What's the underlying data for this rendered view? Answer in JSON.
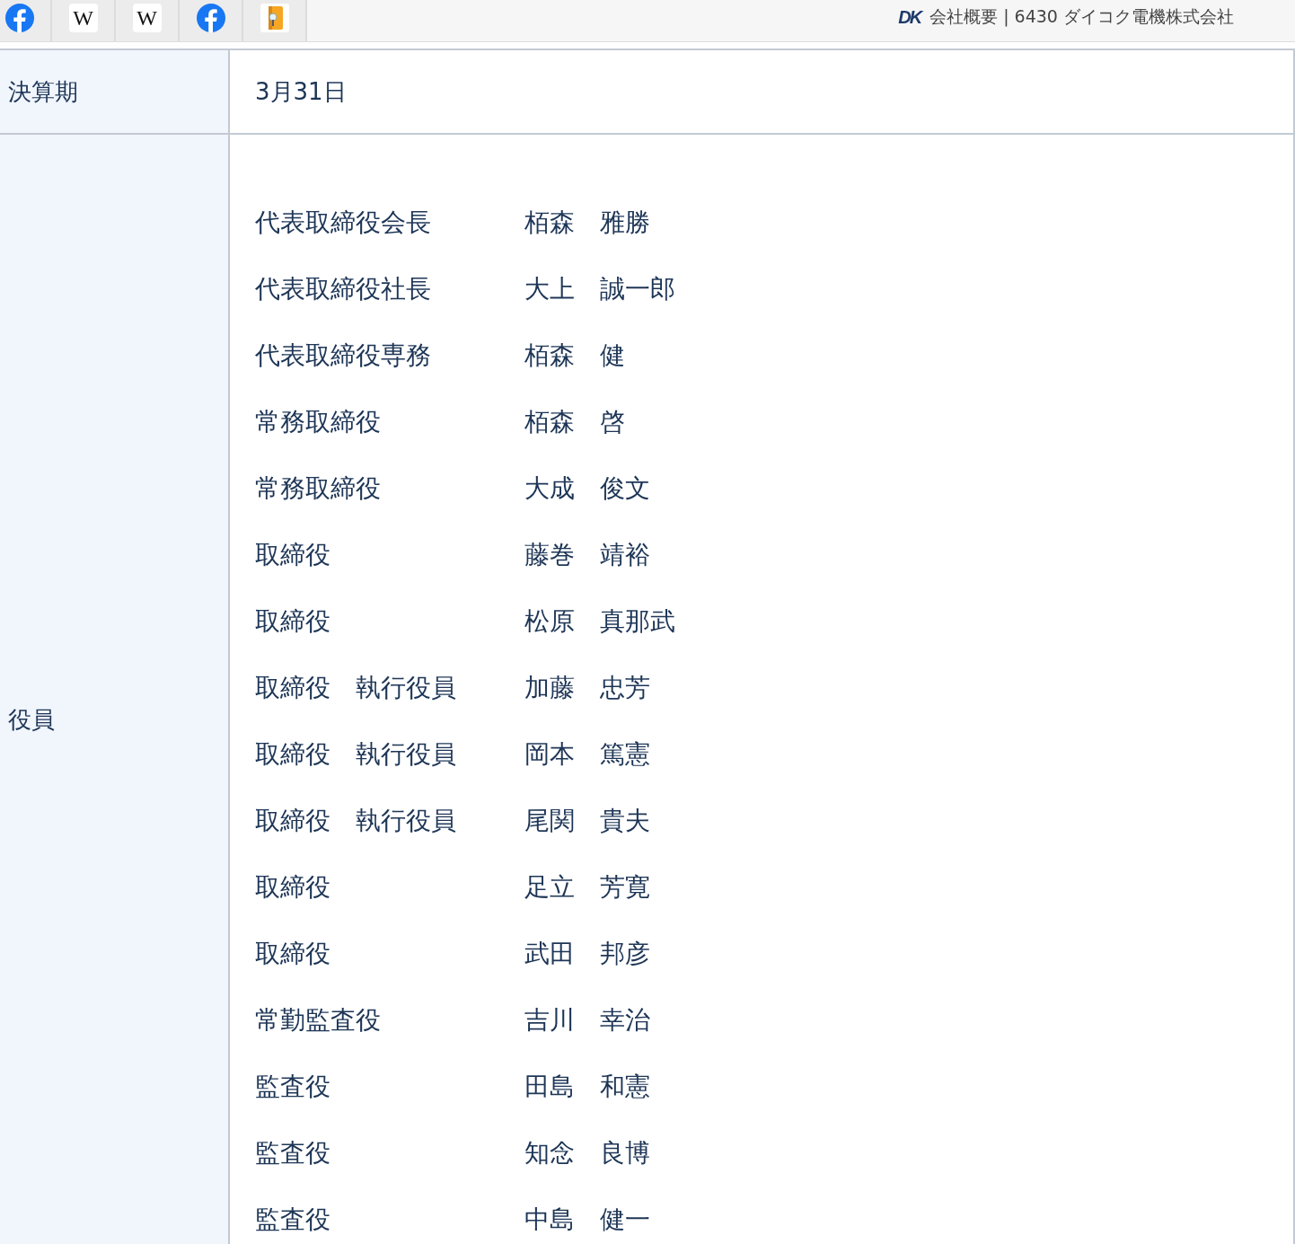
{
  "bookmarks": [
    {
      "kind": "facebook"
    },
    {
      "kind": "wikipedia",
      "label": "W"
    },
    {
      "kind": "wikipedia",
      "label": "W"
    },
    {
      "kind": "facebook"
    },
    {
      "kind": "book"
    }
  ],
  "tab": {
    "logo": "DK",
    "title": "会社概要 | 6430 ダイコク電機株式会社"
  },
  "table": {
    "rows": [
      {
        "label": "決算期",
        "value": "3月31日"
      },
      {
        "label": "役員",
        "officers": [
          {
            "title": "代表取締役会長",
            "name": "栢森　雅勝"
          },
          {
            "title": "代表取締役社長",
            "name": "大上　誠一郎"
          },
          {
            "title": "代表取締役専務",
            "name": "栢森　健"
          },
          {
            "title": "常務取締役",
            "name": "栢森　啓"
          },
          {
            "title": "常務取締役",
            "name": "大成　俊文"
          },
          {
            "title": "取締役",
            "name": "藤巻　靖裕"
          },
          {
            "title": "取締役",
            "name": "松原　真那武"
          },
          {
            "title": "取締役　執行役員",
            "name": "加藤　忠芳"
          },
          {
            "title": "取締役　執行役員",
            "name": "岡本　篤憲"
          },
          {
            "title": "取締役　執行役員",
            "name": "尾関　貴夫"
          },
          {
            "title": "取締役",
            "name": "足立　芳寛"
          },
          {
            "title": "取締役",
            "name": "武田　邦彦"
          },
          {
            "title": "常勤監査役",
            "name": "吉川　幸治"
          },
          {
            "title": "監査役",
            "name": "田島　和憲"
          },
          {
            "title": "監査役",
            "name": "知念　良博"
          },
          {
            "title": "監査役",
            "name": "中島　健一"
          }
        ]
      }
    ]
  }
}
